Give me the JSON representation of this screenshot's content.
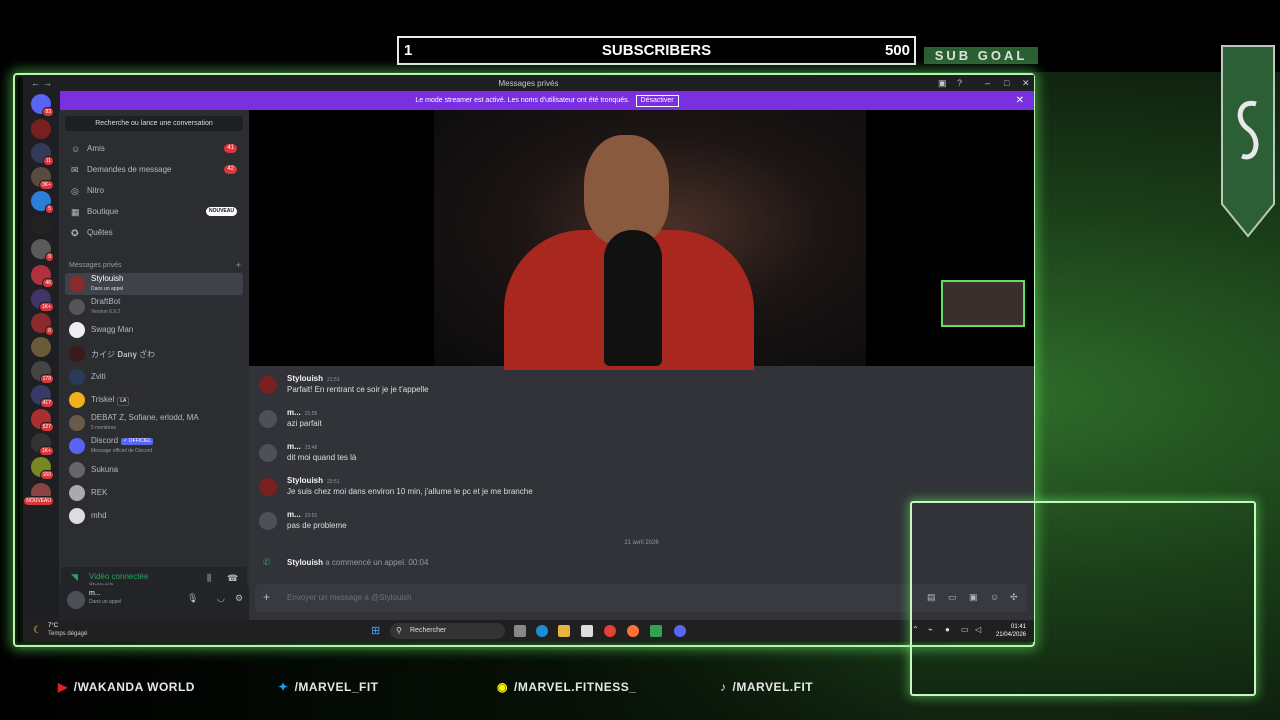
{
  "overlay": {
    "sub_current": "1",
    "sub_label": "SUBSCRIBERS",
    "sub_target": "500",
    "sub_goal": "SUB GOAL",
    "socials": [
      {
        "icon": "youtube-icon",
        "text": "/WAKANDA WORLD"
      },
      {
        "icon": "twitter-icon",
        "text": "/MARVEL_FIT"
      },
      {
        "icon": "snapchat-icon",
        "text": "/MARVEL.FITNESS_"
      },
      {
        "icon": "tiktok-icon",
        "text": "/MARVEL.FIT"
      }
    ]
  },
  "window": {
    "title": "Messages privés"
  },
  "streamer": {
    "text": "Le mode streamer est activé. Les noms d'utilisateur ont été tronqués.",
    "button": "Désactiver"
  },
  "servers": [
    {
      "badge": "83"
    },
    {
      "badge": ""
    },
    {
      "badge": "11"
    },
    {
      "badge": "3K+"
    },
    {
      "badge": "5"
    },
    {
      "badge": ""
    },
    {
      "badge": "9"
    },
    {
      "badge": "46"
    },
    {
      "badge": "1K+"
    },
    {
      "badge": "6"
    },
    {
      "badge": ""
    },
    {
      "badge": "178"
    },
    {
      "badge": "417"
    },
    {
      "badge": "527"
    },
    {
      "badge": "1K+"
    },
    {
      "badge": "160"
    },
    {
      "badge": "NOUVEAU"
    }
  ],
  "sidebar": {
    "search": "Recherche ou lance une conversation",
    "nav": [
      {
        "label": "Amis",
        "count": "41"
      },
      {
        "label": "Demandes de message",
        "count": "42"
      },
      {
        "label": "Nitro",
        "count": ""
      },
      {
        "label": "Boutique",
        "count": ""
      },
      {
        "label": "Quêtes",
        "count": ""
      }
    ],
    "new_badge": "NOUVEAU",
    "dm_header": "Messages privés",
    "dms": [
      {
        "name": "Stylouish",
        "sub": "Dans un appel",
        "tag": ""
      },
      {
        "name": "DraftBot",
        "sub": "Version 6.9.2",
        "tag": ""
      },
      {
        "name": "Swagg Man",
        "sub": "",
        "tag": ""
      },
      {
        "name": "カイジ 𝐃𝐚𝐧𝐲 ざわ",
        "sub": "",
        "tag": ""
      },
      {
        "name": "Zviti",
        "sub": "",
        "tag": ""
      },
      {
        "name": "Triskel",
        "sub": "",
        "tag": "LA"
      },
      {
        "name": "DEBAT Z, Sofiane, erlodd, MA",
        "sub": "5 membres",
        "tag": ""
      },
      {
        "name": "Discord",
        "sub": "Message officiel de Discord",
        "tag": "✓ OFFICIEL"
      },
      {
        "name": "Sukuna",
        "sub": "",
        "tag": ""
      },
      {
        "name": "REK",
        "sub": "",
        "tag": ""
      },
      {
        "name": "mhd",
        "sub": "",
        "tag": ""
      }
    ],
    "voice": {
      "status": "Vidéo connectée",
      "channel": "Stylouish"
    },
    "user": {
      "name": "m...",
      "status": "Dans un appel"
    }
  },
  "messages": [
    {
      "author": "Stylouish",
      "time": "21:51",
      "text": "Parfait! En rentrant ce soir je je t'appelle"
    },
    {
      "author": "m...",
      "time": "21:55",
      "text": "azi parfait"
    },
    {
      "author": "m...",
      "time": "23:46",
      "text": "dit moi quand tes là"
    },
    {
      "author": "Stylouish",
      "time": "23:51",
      "text": "Je suis chez moi dans environ 10 min, j'allume le pc et je me branche"
    },
    {
      "author": "m...",
      "time": "23:51",
      "text": "pas de probleme"
    }
  ],
  "date_separator": "21 avril 2026",
  "call": {
    "author": "Stylouish",
    "text": "a commencé un appel.",
    "time": "00:04"
  },
  "composer": {
    "placeholder": "Envoyer un message à @Stylouish"
  },
  "taskbar": {
    "temp": "7°C",
    "weather": "Temps dégagé",
    "search": "Rechercher",
    "time": "01:41",
    "date": "21/04/2026"
  }
}
